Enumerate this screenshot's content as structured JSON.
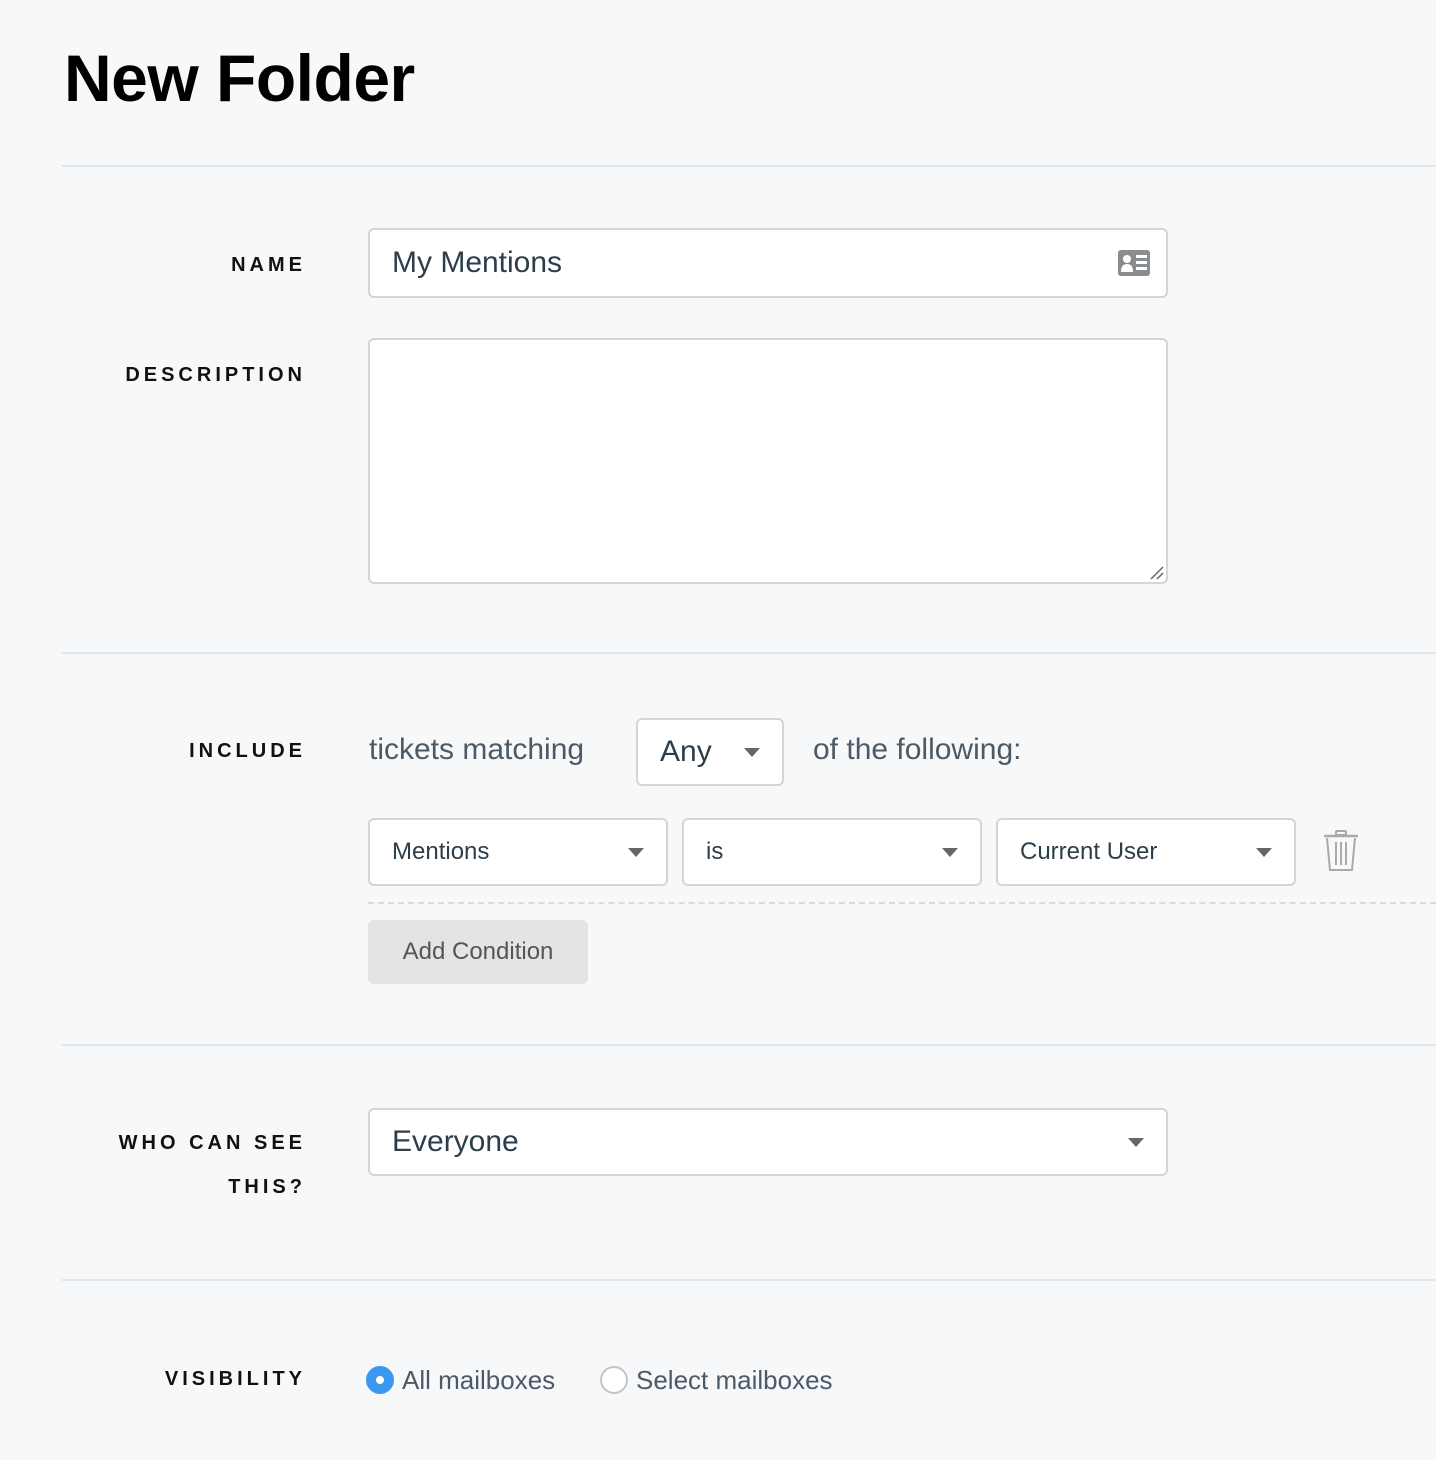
{
  "page": {
    "title": "New Folder"
  },
  "name_field": {
    "label": "NAME",
    "value": "My Mentions",
    "icon": "contact-card-icon"
  },
  "description_field": {
    "label": "DESCRIPTION",
    "value": ""
  },
  "include": {
    "label": "INCLUDE",
    "prefix": "tickets matching",
    "match_select": {
      "value": "Any"
    },
    "suffix": "of the following:",
    "conditions": [
      {
        "field": "Mentions",
        "operator": "is",
        "value": "Current User"
      }
    ],
    "add_condition_label": "Add Condition"
  },
  "who_can_see": {
    "label_line1": "WHO CAN SEE",
    "label_line2": "THIS?",
    "value": "Everyone"
  },
  "visibility": {
    "label": "VISIBILITY",
    "options": [
      {
        "label": "All mailboxes",
        "selected": true
      },
      {
        "label": "Select mailboxes",
        "selected": false
      }
    ]
  },
  "colors": {
    "accent": "#3b97f0",
    "background": "#f7f8fa"
  }
}
